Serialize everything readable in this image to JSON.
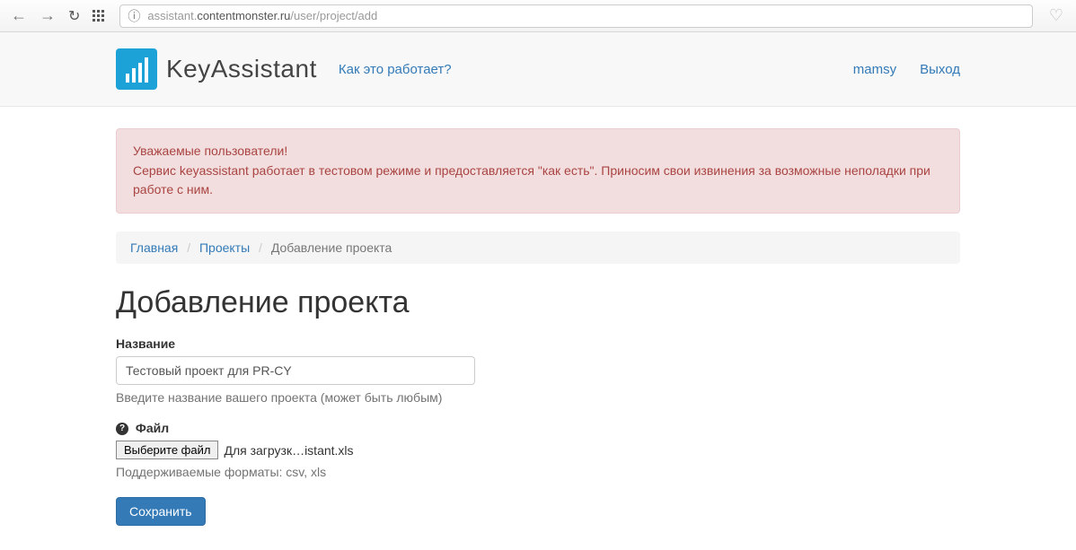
{
  "browser": {
    "url_prefix": "assistant.",
    "url_domain": "contentmonster.ru",
    "url_path": "/user/project/add"
  },
  "header": {
    "logo_text": "KeyAssistant",
    "how_link": "Как это работает?",
    "nav": {
      "user": "mamsy",
      "logout": "Выход"
    }
  },
  "alert": {
    "line1": "Уважаемые пользователи!",
    "line2": "Сервис keyassistant работает в тестовом режиме и предоставляется \"как есть\". Приносим свои извинения за возможные неполадки при работе с ним."
  },
  "breadcrumb": {
    "home": "Главная",
    "projects": "Проекты",
    "current": "Добавление проекта"
  },
  "page": {
    "title": "Добавление проекта",
    "name_label": "Название",
    "name_value": "Тестовый проект для PR-CY",
    "name_help": "Введите название вашего проекта (может быть любым)",
    "file_label": "Файл",
    "file_button": "Выберите файл",
    "file_selected": "Для загрузк…istant.xls",
    "file_help": "Поддерживаемые форматы: csv, xls",
    "submit": "Сохранить"
  }
}
